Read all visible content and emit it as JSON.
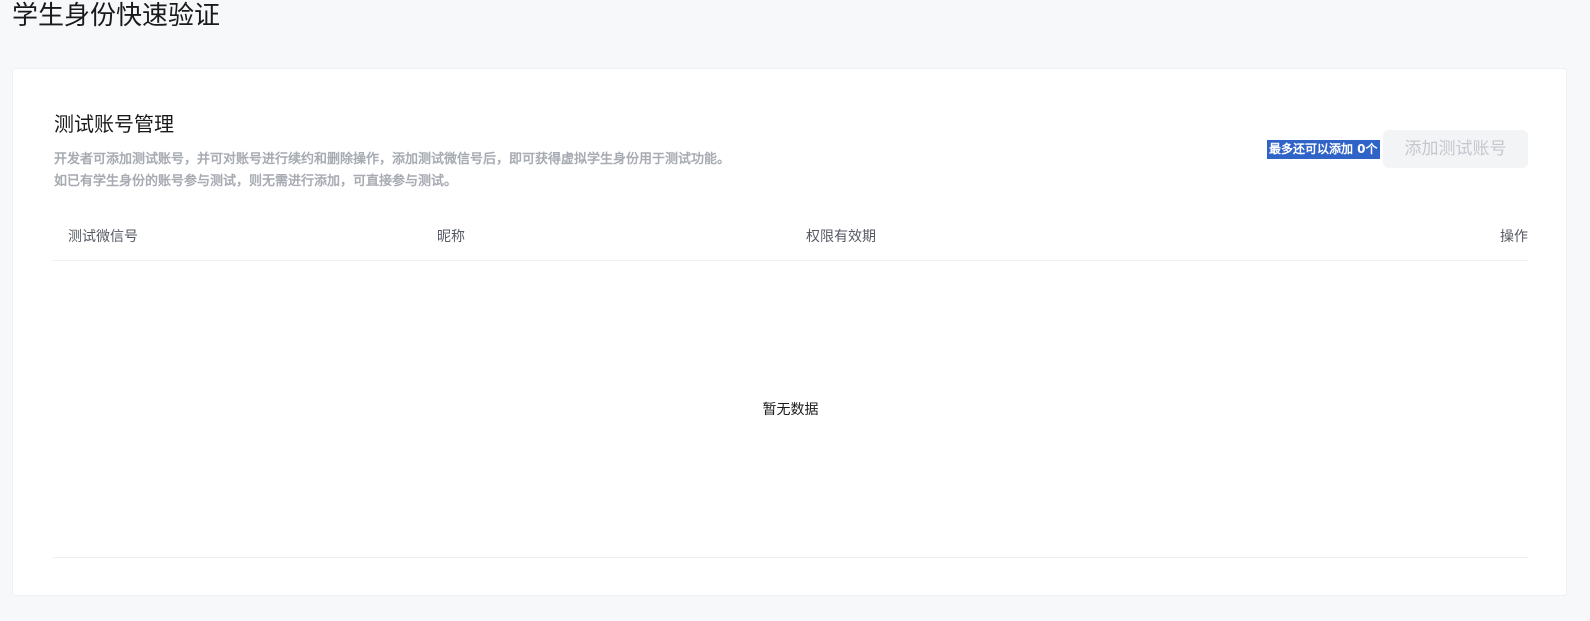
{
  "page": {
    "title": "学生身份快速验证"
  },
  "section": {
    "title": "测试账号管理",
    "desc_line1": "开发者可添加测试账号，并可对账号进行续约和删除操作，添加测试微信号后，即可获得虚拟学生身份用于测试功能。",
    "desc_line2": "如已有学生身份的账号参与测试，则无需进行添加，可直接参与测试。"
  },
  "quota": {
    "note": "最多还可以添加 0个"
  },
  "toolbar": {
    "add_label": "添加测试账号"
  },
  "table": {
    "columns": [
      "测试微信号",
      "昵称",
      "权限有效期",
      "操作"
    ],
    "rows": [],
    "empty_text": "暂无数据"
  },
  "colors": {
    "page_bg": "#f7f8fa",
    "card_bg": "#ffffff",
    "selection_highlight": "#2f63c8",
    "muted_text": "#a7abb2",
    "disabled_button_bg": "#f3f4f6"
  }
}
